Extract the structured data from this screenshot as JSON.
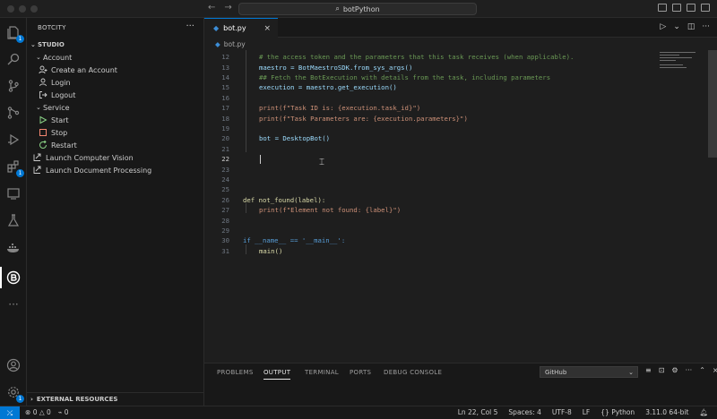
{
  "title_bar": {
    "search_text": "botPython"
  },
  "sidebar": {
    "header": "BOTCITY",
    "section": "STUDIO",
    "groups": [
      {
        "label": "Account",
        "items": [
          {
            "label": "Create an Account"
          },
          {
            "label": "Login"
          },
          {
            "label": "Logout"
          }
        ]
      },
      {
        "label": "Service",
        "items": [
          {
            "label": "Start"
          },
          {
            "label": "Stop"
          },
          {
            "label": "Restart"
          }
        ]
      }
    ],
    "links": [
      {
        "label": "Launch Computer Vision"
      },
      {
        "label": "Launch Document Processing"
      }
    ],
    "footer": "EXTERNAL RESOURCES"
  },
  "activity_bar": {
    "badges": {
      "explorer": "1",
      "extensions": "1",
      "settings": "1"
    }
  },
  "editor": {
    "tab": "bot.py",
    "breadcrumb": "bot.py",
    "lines": [
      {
        "n": "12",
        "text": "# the access token and the parameters that this task receives (when applicable)."
      },
      {
        "n": "13",
        "text": "maestro = BotMaestroSDK.from_sys_args()"
      },
      {
        "n": "14",
        "text": "## Fetch the BotExecution with details from the task, including parameters"
      },
      {
        "n": "15",
        "text": "execution = maestro.get_execution()"
      },
      {
        "n": "16",
        "text": ""
      },
      {
        "n": "17",
        "text": "print(f\"Task ID is: {execution.task_id}\")"
      },
      {
        "n": "18",
        "text": "print(f\"Task Parameters are: {execution.parameters}\")"
      },
      {
        "n": "19",
        "text": ""
      },
      {
        "n": "20",
        "text": "bot = DesktopBot()"
      },
      {
        "n": "21",
        "text": ""
      },
      {
        "n": "22",
        "text": ""
      },
      {
        "n": "23",
        "text": ""
      },
      {
        "n": "24",
        "text": ""
      },
      {
        "n": "25",
        "text": ""
      },
      {
        "n": "26",
        "text": "def not_found(label):"
      },
      {
        "n": "27",
        "text": "print(f\"Element not found: {label}\")"
      },
      {
        "n": "28",
        "text": ""
      },
      {
        "n": "29",
        "text": ""
      },
      {
        "n": "30",
        "text": "if __name__ == '__main__':"
      },
      {
        "n": "31",
        "text": "main()"
      }
    ]
  },
  "panel": {
    "tabs": [
      {
        "label": "PROBLEMS"
      },
      {
        "label": "OUTPUT"
      },
      {
        "label": "TERMINAL"
      },
      {
        "label": "PORTS"
      },
      {
        "label": "DEBUG CONSOLE"
      }
    ],
    "active_tab": "OUTPUT",
    "output_channel": "GitHub"
  },
  "status_bar": {
    "errors": "0",
    "warnings": "0",
    "ports": "0",
    "cursor": "Ln 22, Col 5",
    "spaces": "Spaces: 4",
    "encoding": "UTF-8",
    "eol": "LF",
    "language": "Python",
    "interpreter": "3.11.0 64-bit"
  },
  "colors": {
    "accent": "#0078d4",
    "keyword": "#569cd6",
    "function": "#dcdcaa",
    "string": "#ce9178",
    "comment": "#6a9955"
  }
}
